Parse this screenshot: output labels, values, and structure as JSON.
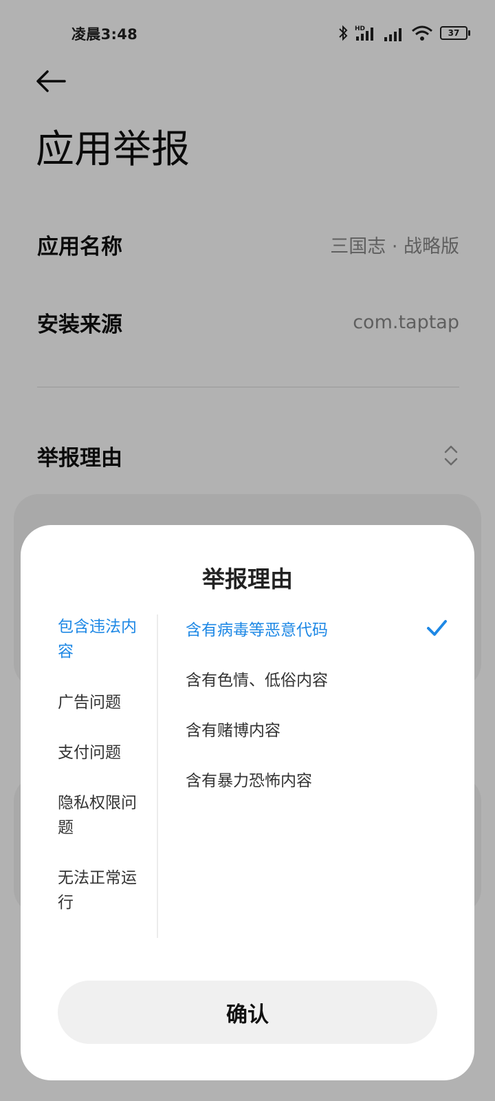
{
  "status_bar": {
    "time": "凌晨3:48",
    "battery": "37",
    "icons": [
      "bluetooth-icon",
      "hd-signal-icon",
      "signal-icon",
      "wifi-icon",
      "battery-icon"
    ]
  },
  "page": {
    "title": "应用举报",
    "app_name_label": "应用名称",
    "app_name_value": "三国志 · 战略版",
    "source_label": "安装来源",
    "source_value": "com.taptap",
    "reason_label": "举报理由"
  },
  "sheet": {
    "title": "举报理由",
    "categories": [
      {
        "label": "包含违法内容",
        "selected": true
      },
      {
        "label": "广告问题",
        "selected": false
      },
      {
        "label": "支付问题",
        "selected": false
      },
      {
        "label": "隐私权限问题",
        "selected": false
      },
      {
        "label": "无法正常运行",
        "selected": false
      }
    ],
    "reasons": [
      {
        "label": "含有病毒等恶意代码",
        "selected": true
      },
      {
        "label": "含有色情、低俗内容",
        "selected": false
      },
      {
        "label": "含有赌博内容",
        "selected": false
      },
      {
        "label": "含有暴力恐怖内容",
        "selected": false
      }
    ],
    "confirm_label": "确认"
  },
  "colors": {
    "accent": "#1e88e5",
    "scrim": "rgba(0,0,0,0.3)",
    "sheet_bg": "#ffffff",
    "button_bg": "#f0f0f0"
  }
}
